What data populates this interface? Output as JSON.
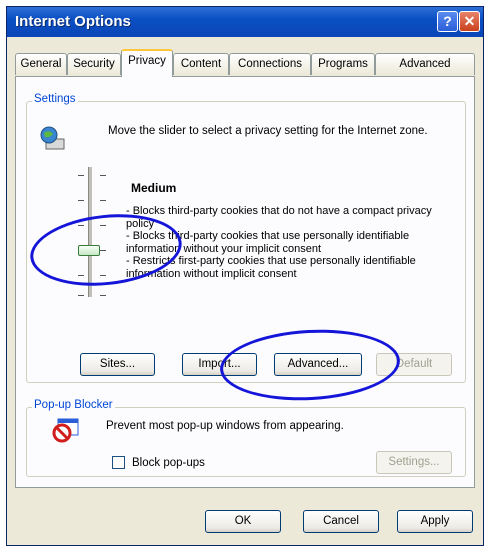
{
  "window": {
    "title": "Internet Options"
  },
  "titlebar": {
    "help_glyph": "?",
    "close_glyph": "✕"
  },
  "tabs": [
    {
      "label": "General",
      "active": false
    },
    {
      "label": "Security",
      "active": false
    },
    {
      "label": "Privacy",
      "active": true
    },
    {
      "label": "Content",
      "active": false
    },
    {
      "label": "Connections",
      "active": false
    },
    {
      "label": "Programs",
      "active": false
    },
    {
      "label": "Advanced",
      "active": false
    }
  ],
  "settings": {
    "group_label": "Settings",
    "description": "Move the slider to select a privacy setting for the Internet zone.",
    "level_title": "Medium",
    "bullets": [
      "- Blocks third-party cookies that do not have a compact privacy policy",
      "- Blocks third-party cookies that use personally identifiable information without your implicit consent",
      "- Restricts first-party cookies that use personally identifiable information without implicit consent"
    ],
    "slider_level": 0.5,
    "buttons": {
      "sites": "Sites...",
      "import": "Import...",
      "advanced": "Advanced...",
      "default": "Default"
    }
  },
  "popup": {
    "group_label": "Pop-up Blocker",
    "description": "Prevent most pop-up windows from appearing.",
    "checkbox_label": "Block pop-ups",
    "block_checked": false,
    "settings_button": "Settings..."
  },
  "dialog_buttons": {
    "ok": "OK",
    "cancel": "Cancel",
    "apply": "Apply"
  },
  "colors": {
    "annotation": "#1515d9",
    "group_label": "#0046d5",
    "titlebar": "#0a4fc4"
  }
}
